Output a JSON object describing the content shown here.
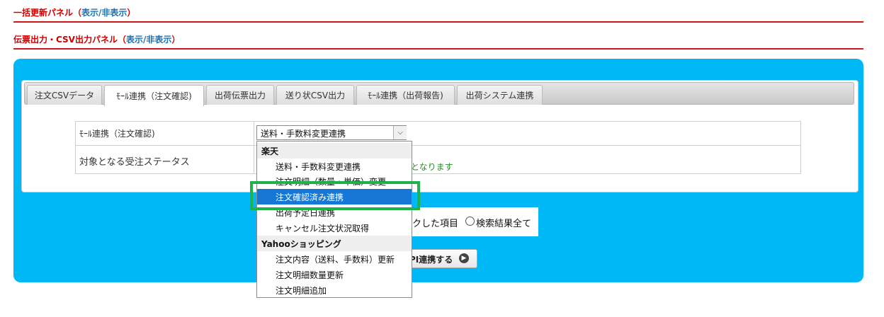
{
  "panels": {
    "bulk_update": {
      "title": "一括更新パネル",
      "open_paren": "（",
      "toggle": "表示/非表示",
      "close_paren": "）"
    },
    "csv_output": {
      "title": "伝票出力・CSV出力パネル",
      "open_paren": "（",
      "toggle": "表示/非表示",
      "close_paren": "）"
    }
  },
  "tabs": [
    {
      "label": "注文CSVデータ",
      "active": false
    },
    {
      "label": "ﾓｰﾙ連携（注文確認)",
      "active": true
    },
    {
      "label": "出荷伝票出力",
      "active": false
    },
    {
      "label": "送り状CSV出力",
      "active": false
    },
    {
      "label": "ﾓｰﾙ連携（出荷報告)",
      "active": false
    },
    {
      "label": "出荷システム連携",
      "active": false
    }
  ],
  "form": {
    "row1_label": "ﾓｰﾙ連携（注文確認)",
    "select_value": "送料・手数料変更連携",
    "row2_label": "対象となる受注ステータス",
    "row2_note": "となります"
  },
  "dropdown": {
    "groups": [
      {
        "label": "楽天",
        "options": [
          "送料・手数料変更連携",
          "注文明細（数量・単価）変更",
          "注文確認済み連携",
          "出荷予定日連携",
          "キャンセル注文状況取得"
        ]
      },
      {
        "label": "Yahooショッピング",
        "options": [
          "注文内容（送料、手数料）更新",
          "注文明細数量更新",
          "注文明細追加"
        ]
      }
    ],
    "selected": "注文確認済み連携"
  },
  "radios": {
    "option1_partial": "クした項目",
    "option2": "検索結果全て"
  },
  "api_button": {
    "label": "PI連携する"
  },
  "colors": {
    "accent_red": "#cc1a1a",
    "panel_blue": "#00b8f5",
    "selected_blue": "#1677d6",
    "highlight_green": "#1fb24a",
    "note_green": "#2a8a2a"
  }
}
